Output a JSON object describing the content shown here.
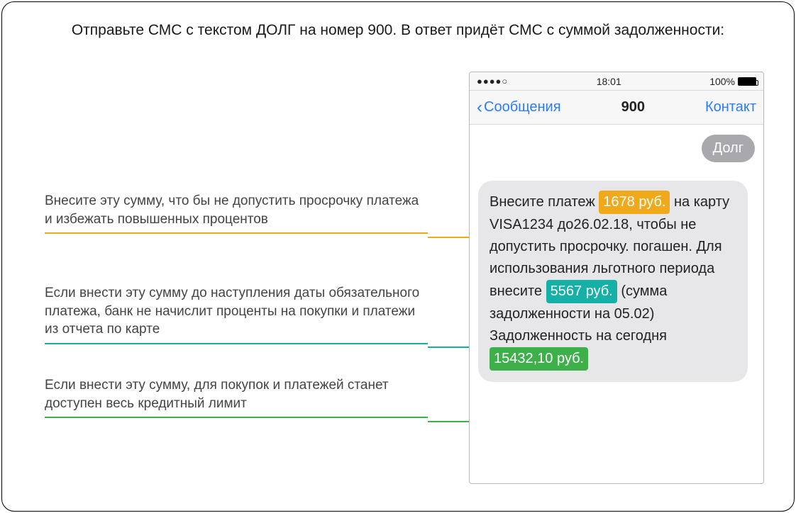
{
  "headline": "Отправьте СМС с текстом ДОЛГ на номер 900. В ответ придёт СМС с суммой задолженности:",
  "annot": {
    "orange": "Внесите эту сумму, что бы не допустить просрочку платежа и избежать повышенных процентов",
    "teal": "Если внести эту сумму до наступления даты обязательного платежа, банк не начислит проценты на покупки и платежи из отчета по карте",
    "green": "Если внести эту сумму, для покупок и платежей станет доступен весь кредитный лимит"
  },
  "phone": {
    "status": {
      "signal": "●●●●○",
      "time": "18:01",
      "pct": "100%"
    },
    "nav": {
      "back": "Сообщения",
      "title": "900",
      "right": "Контакт"
    },
    "outgoing": "Долг",
    "sms": {
      "p1a": "Внесите платеж",
      "amt1": "1678 руб.",
      "p1b": "на карту VISA1234 до26.02.18, чтобы не допустить просрочку. погашен. Для использования льготного периода внесите",
      "amt2": "5567 руб.",
      "p1c": "(сумма задолженности на 05.02) Задолженность на сегодня",
      "amt3": "15432,10 руб."
    }
  },
  "colors": {
    "orange": "#f0a91b",
    "teal": "#15b0a6",
    "green": "#3eb04a"
  }
}
